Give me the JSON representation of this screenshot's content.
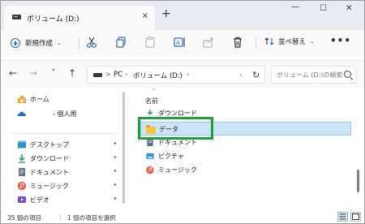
{
  "window": {
    "tab_title": "ボリューム (D:)",
    "tab_close": "×",
    "new_tab": "+",
    "minimize": "—",
    "maximize": "☐",
    "close": "✕"
  },
  "toolbar": {
    "new_label": "新規作成",
    "sort_label": "並べ替え",
    "more": "•••",
    "icons": [
      "cut-icon",
      "copy-icon",
      "paste-icon",
      "rename-icon",
      "share-icon",
      "delete-icon"
    ]
  },
  "nav": {
    "back": "←",
    "forward": "→",
    "recent": "⌄",
    "up": "↑",
    "breadcrumb": [
      "PC",
      "ボリューム (D:)"
    ],
    "breadcrumb_sep": "›",
    "breadcrumb_chevron": ">",
    "refresh": "↻",
    "search_placeholder": "ボリューム (D:)の検索"
  },
  "sidebar": {
    "items": [
      {
        "label": "ホーム",
        "icon": "home-icon",
        "pinned": false
      },
      {
        "label": "- 個人用",
        "icon": "onedrive-icon",
        "pinned": false
      },
      {
        "label": "デスクトップ",
        "icon": "desktop-icon",
        "pinned": true
      },
      {
        "label": "ダウンロード",
        "icon": "download-icon",
        "pinned": true
      },
      {
        "label": "ドキュメント",
        "icon": "document-icon",
        "pinned": true
      },
      {
        "label": "ミュージック",
        "icon": "music-icon",
        "pinned": true
      },
      {
        "label": "ビデオ",
        "icon": "video-icon",
        "pinned": true
      }
    ],
    "pin_glyph": "📌"
  },
  "content": {
    "column_header": "名前",
    "sort_arrow": "^",
    "rows": [
      {
        "label": "ダウンロード",
        "icon": "download-icon"
      },
      {
        "label": "データ",
        "icon": "folder-icon",
        "selected": true
      },
      {
        "label": "ドキュメント",
        "icon": "document-icon"
      },
      {
        "label": "ピクチャ",
        "icon": "picture-icon"
      },
      {
        "label": "ミュージック",
        "icon": "music-icon"
      }
    ]
  },
  "status": {
    "item_count": "35 個の項目",
    "selected_count": "1 個の項目を選択"
  },
  "colors": {
    "accent": "#1f6bd8",
    "selection": "#cce4f7",
    "highlight_box": "#1ea33a"
  }
}
